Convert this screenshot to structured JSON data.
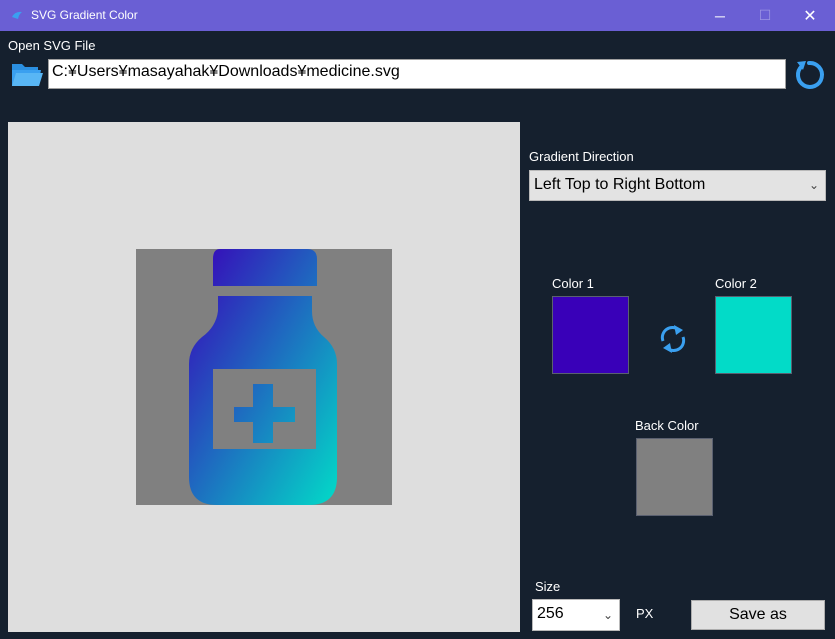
{
  "window": {
    "title": "SVG Gradient Color",
    "minimize_glyph": "─",
    "maximize_glyph": "☐",
    "close_glyph": "✕"
  },
  "file": {
    "label": "Open SVG File",
    "path": "C:¥Users¥masayahak¥Downloads¥medicine.svg",
    "open_icon": "folder-open-icon",
    "reload_icon": "refresh-icon"
  },
  "gradient": {
    "label": "Gradient Direction",
    "selected": "Left Top to Right Bottom"
  },
  "colors": {
    "color1_label": "Color 1",
    "color1": "#3900b8",
    "color2_label": "Color 2",
    "color2": "#02dbc8",
    "back_label": "Back Color",
    "back": "#808080",
    "swap_icon": "swap-arrows-icon"
  },
  "output": {
    "size_label": "Size",
    "size": "256",
    "unit": "PX",
    "save_label": "Save as"
  },
  "theme": {
    "titlebar": "#6a5fd4",
    "background": "#15202e",
    "accent": "#3aa0f0"
  }
}
